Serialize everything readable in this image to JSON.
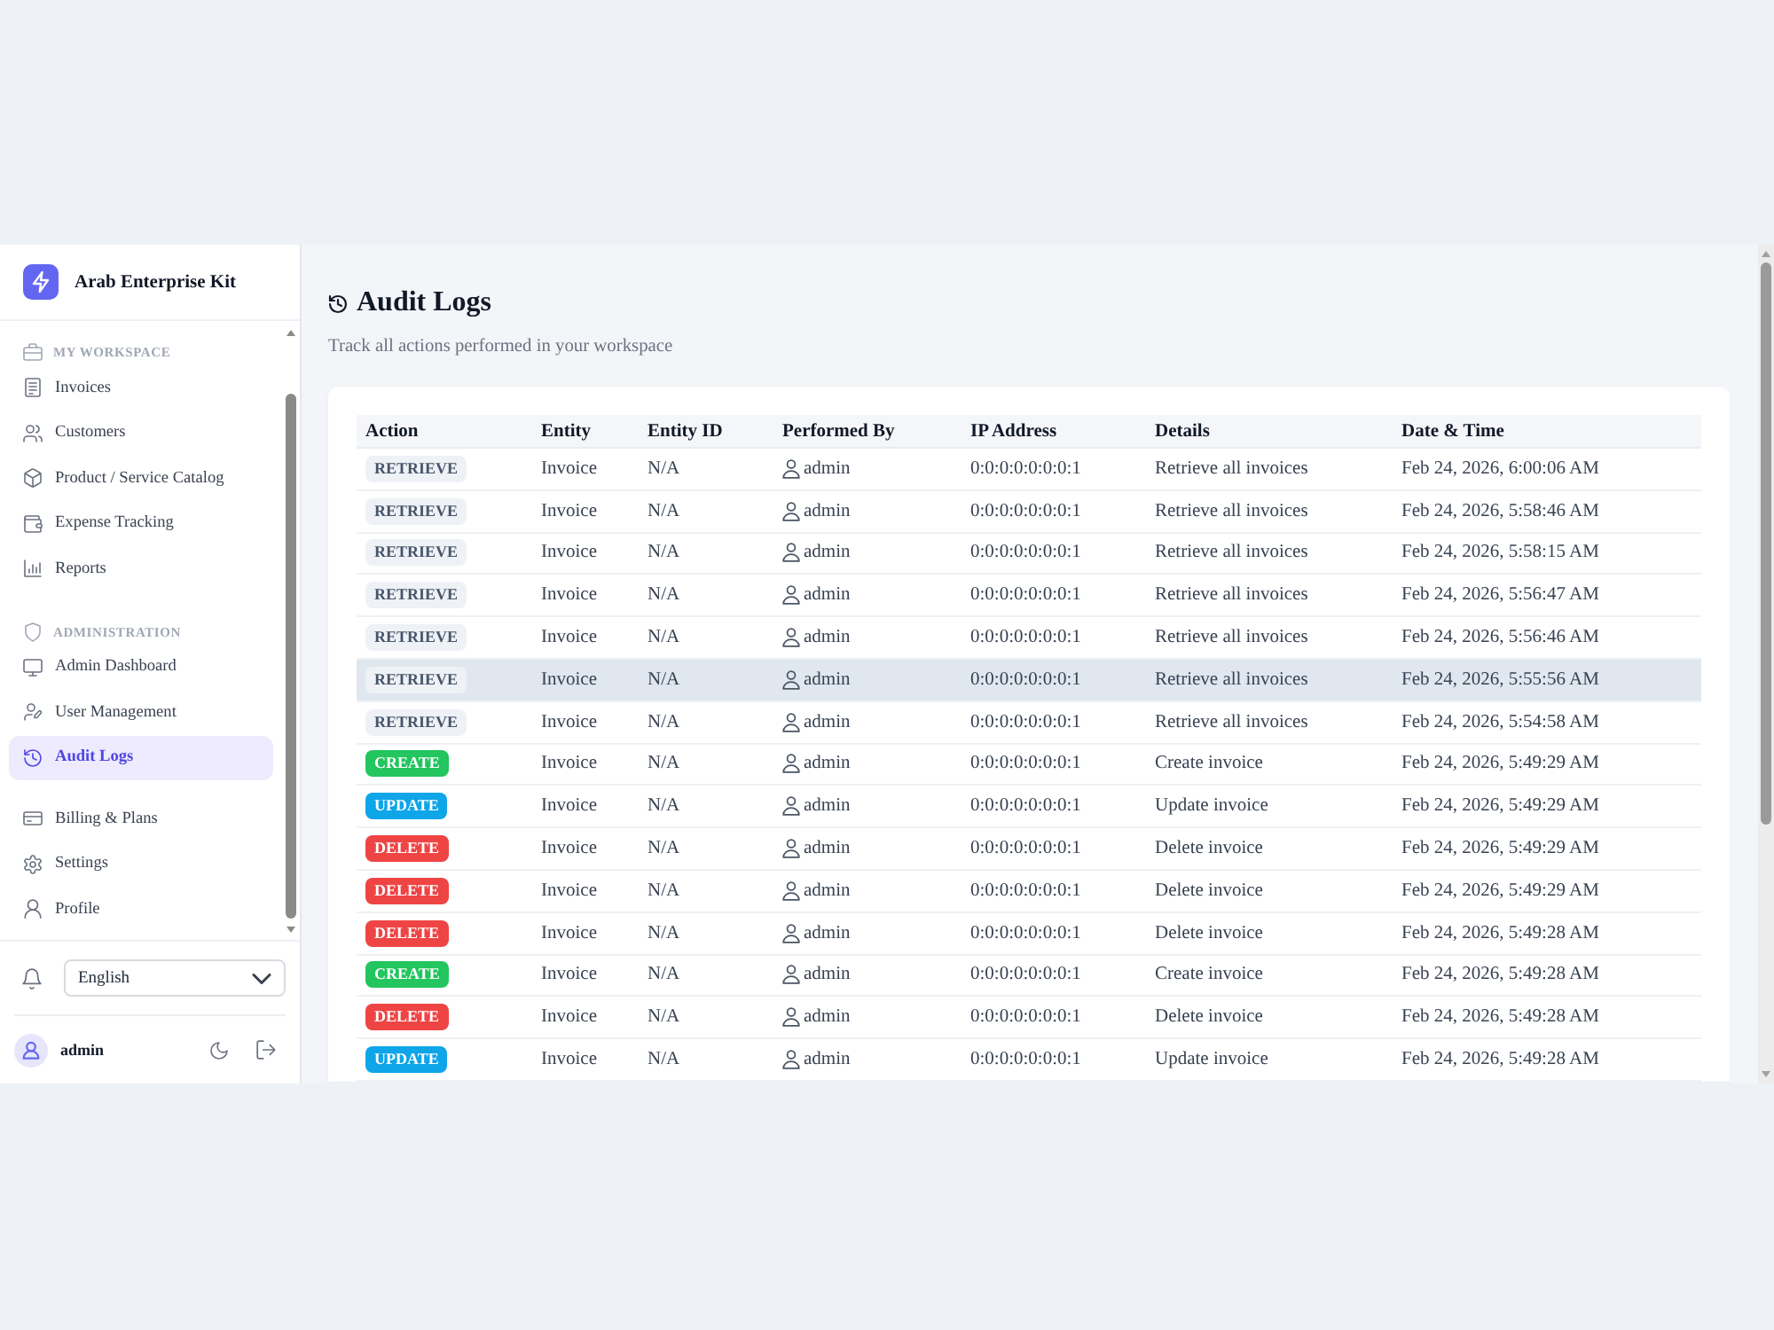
{
  "sidebar": {
    "brand": "Arab Enterprise Kit",
    "groups": [
      {
        "heading": "MY WORKSPACE",
        "items": [
          {
            "label": "Invoices",
            "selected": false
          },
          {
            "label": "Customers",
            "selected": false
          },
          {
            "label": "Product / Service Catalog",
            "selected": false
          },
          {
            "label": "Expense Tracking",
            "selected": false
          },
          {
            "label": "Reports",
            "selected": false
          }
        ]
      },
      {
        "heading": "ADMINISTRATION",
        "items": [
          {
            "label": "Admin Dashboard",
            "selected": false
          },
          {
            "label": "User Management",
            "selected": false
          },
          {
            "label": "Audit Logs",
            "selected": true
          }
        ]
      },
      {
        "items": [
          {
            "label": "Billing & Plans",
            "selected": false
          },
          {
            "label": "Settings",
            "selected": false
          },
          {
            "label": "Profile",
            "selected": false
          }
        ]
      }
    ],
    "language": {
      "value": "English"
    },
    "user": {
      "name": "admin"
    }
  },
  "page": {
    "title": "Audit Logs",
    "subtitle": "Track all actions performed in your workspace",
    "table": {
      "columns": [
        "Action",
        "Entity",
        "Entity ID",
        "Performed By",
        "IP Address",
        "Details",
        "Date & Time"
      ],
      "rows": [
        {
          "action": {
            "label": "RETRIEVE",
            "color": "#eef2f7"
          },
          "entity": "Invoice",
          "entity_id": "N/A",
          "performed_by": "admin",
          "ip_address": "0:0:0:0:0:0:0:1",
          "details": "Retrieve all invoices",
          "date_time": "Feb 24, 2026, 6:00:06 AM",
          "hovered": false
        },
        {
          "action": {
            "label": "RETRIEVE",
            "color": "#eef2f7"
          },
          "entity": "Invoice",
          "entity_id": "N/A",
          "performed_by": "admin",
          "ip_address": "0:0:0:0:0:0:0:1",
          "details": "Retrieve all invoices",
          "date_time": "Feb 24, 2026, 5:58:46 AM",
          "hovered": false
        },
        {
          "action": {
            "label": "RETRIEVE",
            "color": "#eef2f7"
          },
          "entity": "Invoice",
          "entity_id": "N/A",
          "performed_by": "admin",
          "ip_address": "0:0:0:0:0:0:0:1",
          "details": "Retrieve all invoices",
          "date_time": "Feb 24, 2026, 5:58:15 AM",
          "hovered": false
        },
        {
          "action": {
            "label": "RETRIEVE",
            "color": "#eef2f7"
          },
          "entity": "Invoice",
          "entity_id": "N/A",
          "performed_by": "admin",
          "ip_address": "0:0:0:0:0:0:0:1",
          "details": "Retrieve all invoices",
          "date_time": "Feb 24, 2026, 5:56:47 AM",
          "hovered": false
        },
        {
          "action": {
            "label": "RETRIEVE",
            "color": "#eef2f7"
          },
          "entity": "Invoice",
          "entity_id": "N/A",
          "performed_by": "admin",
          "ip_address": "0:0:0:0:0:0:0:1",
          "details": "Retrieve all invoices",
          "date_time": "Feb 24, 2026, 5:56:46 AM",
          "hovered": false
        },
        {
          "action": {
            "label": "RETRIEVE",
            "color": "#eef2f7"
          },
          "entity": "Invoice",
          "entity_id": "N/A",
          "performed_by": "admin",
          "ip_address": "0:0:0:0:0:0:0:1",
          "details": "Retrieve all invoices",
          "date_time": "Feb 24, 2026, 5:55:56 AM",
          "hovered": true
        },
        {
          "action": {
            "label": "RETRIEVE",
            "color": "#eef2f7"
          },
          "entity": "Invoice",
          "entity_id": "N/A",
          "performed_by": "admin",
          "ip_address": "0:0:0:0:0:0:0:1",
          "details": "Retrieve all invoices",
          "date_time": "Feb 24, 2026, 5:54:58 AM",
          "hovered": false
        },
        {
          "action": {
            "label": "CREATE",
            "color": "#22c55e"
          },
          "entity": "Invoice",
          "entity_id": "N/A",
          "performed_by": "admin",
          "ip_address": "0:0:0:0:0:0:0:1",
          "details": "Create invoice",
          "date_time": "Feb 24, 2026, 5:49:29 AM",
          "hovered": false
        },
        {
          "action": {
            "label": "UPDATE",
            "color": "#0ea5e9"
          },
          "entity": "Invoice",
          "entity_id": "N/A",
          "performed_by": "admin",
          "ip_address": "0:0:0:0:0:0:0:1",
          "details": "Update invoice",
          "date_time": "Feb 24, 2026, 5:49:29 AM",
          "hovered": false
        },
        {
          "action": {
            "label": "DELETE",
            "color": "#ef4444"
          },
          "entity": "Invoice",
          "entity_id": "N/A",
          "performed_by": "admin",
          "ip_address": "0:0:0:0:0:0:0:1",
          "details": "Delete invoice",
          "date_time": "Feb 24, 2026, 5:49:29 AM",
          "hovered": false
        },
        {
          "action": {
            "label": "DELETE",
            "color": "#ef4444"
          },
          "entity": "Invoice",
          "entity_id": "N/A",
          "performed_by": "admin",
          "ip_address": "0:0:0:0:0:0:0:1",
          "details": "Delete invoice",
          "date_time": "Feb 24, 2026, 5:49:29 AM",
          "hovered": false
        },
        {
          "action": {
            "label": "DELETE",
            "color": "#ef4444"
          },
          "entity": "Invoice",
          "entity_id": "N/A",
          "performed_by": "admin",
          "ip_address": "0:0:0:0:0:0:0:1",
          "details": "Delete invoice",
          "date_time": "Feb 24, 2026, 5:49:28 AM",
          "hovered": false
        },
        {
          "action": {
            "label": "CREATE",
            "color": "#22c55e"
          },
          "entity": "Invoice",
          "entity_id": "N/A",
          "performed_by": "admin",
          "ip_address": "0:0:0:0:0:0:0:1",
          "details": "Create invoice",
          "date_time": "Feb 24, 2026, 5:49:28 AM",
          "hovered": false
        },
        {
          "action": {
            "label": "DELETE",
            "color": "#ef4444"
          },
          "entity": "Invoice",
          "entity_id": "N/A",
          "performed_by": "admin",
          "ip_address": "0:0:0:0:0:0:0:1",
          "details": "Delete invoice",
          "date_time": "Feb 24, 2026, 5:49:28 AM",
          "hovered": false
        },
        {
          "action": {
            "label": "UPDATE",
            "color": "#0ea5e9"
          },
          "entity": "Invoice",
          "entity_id": "N/A",
          "performed_by": "admin",
          "ip_address": "0:0:0:0:0:0:0:1",
          "details": "Update invoice",
          "date_time": "Feb 24, 2026, 5:49:28 AM",
          "hovered": false
        }
      ]
    }
  }
}
